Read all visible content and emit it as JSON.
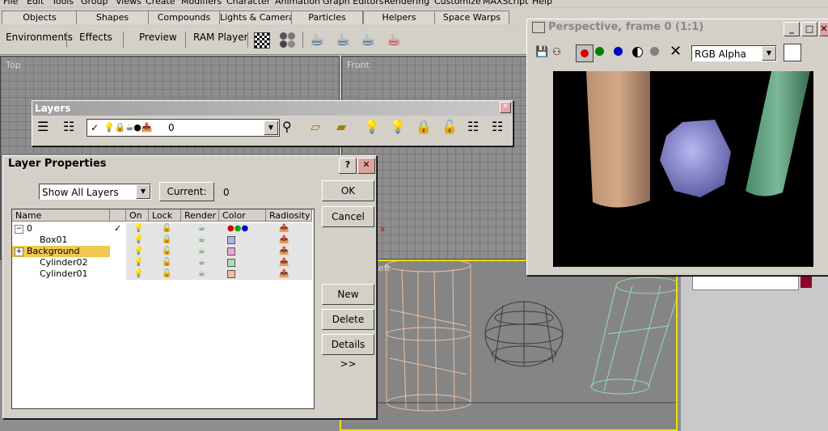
{
  "menu": [
    "File",
    "Edit",
    "Tools",
    "Group",
    "Views",
    "Create",
    "Modifiers",
    "Character",
    "Animation",
    "Graph Editors",
    "Rendering",
    "Customize",
    "MAXScript",
    "Help"
  ],
  "tabs": [
    "Objects",
    "Shapes",
    "Compounds",
    "Lights & Cameras",
    "Particles",
    "Helpers",
    "Space Warps"
  ],
  "toolbar": {
    "environments": "Environments",
    "effects": "Effects",
    "preview": "Preview",
    "ram_player": "RAM Player"
  },
  "viewports": {
    "top": "Top",
    "front": "Front",
    "persp_label": "Left"
  },
  "layers_toolbar": {
    "title": "Layers",
    "current_layer": "0"
  },
  "layer_properties": {
    "title": "Layer Properties",
    "filter": "Show All Layers",
    "current_button": "Current:",
    "current_value": "0",
    "columns": [
      "Name",
      "On",
      "Lock",
      "Render",
      "Color",
      "Radiosity"
    ],
    "rows": [
      {
        "name": "0",
        "checked": "✓",
        "expander": "−",
        "indent": 0,
        "highlight": false,
        "color": "multi"
      },
      {
        "name": "Box01",
        "checked": "",
        "expander": "",
        "indent": 1,
        "highlight": false,
        "color": "#a9b4e8"
      },
      {
        "name": "Background",
        "checked": "",
        "expander": "+",
        "indent": 0,
        "highlight": true,
        "color": "#e8a8d8"
      },
      {
        "name": "Cylinder02",
        "checked": "",
        "expander": "",
        "indent": 1,
        "highlight": false,
        "color": "#a8e0b8"
      },
      {
        "name": "Cylinder01",
        "checked": "",
        "expander": "",
        "indent": 1,
        "highlight": false,
        "color": "#f0c0a0"
      }
    ],
    "buttons": {
      "ok": "OK",
      "cancel": "Cancel",
      "new": "New",
      "delete": "Delete",
      "details": "Details >>"
    }
  },
  "render_window": {
    "title": "Perspective, frame 0 (1:1)",
    "channel": "RGB Alpha"
  },
  "colors": {
    "highlight": "#f0c850",
    "cyl1": "#c8a088",
    "cyl2": "#6aa888",
    "sphere": "#8888cc",
    "accent_red": "#cc0000"
  }
}
